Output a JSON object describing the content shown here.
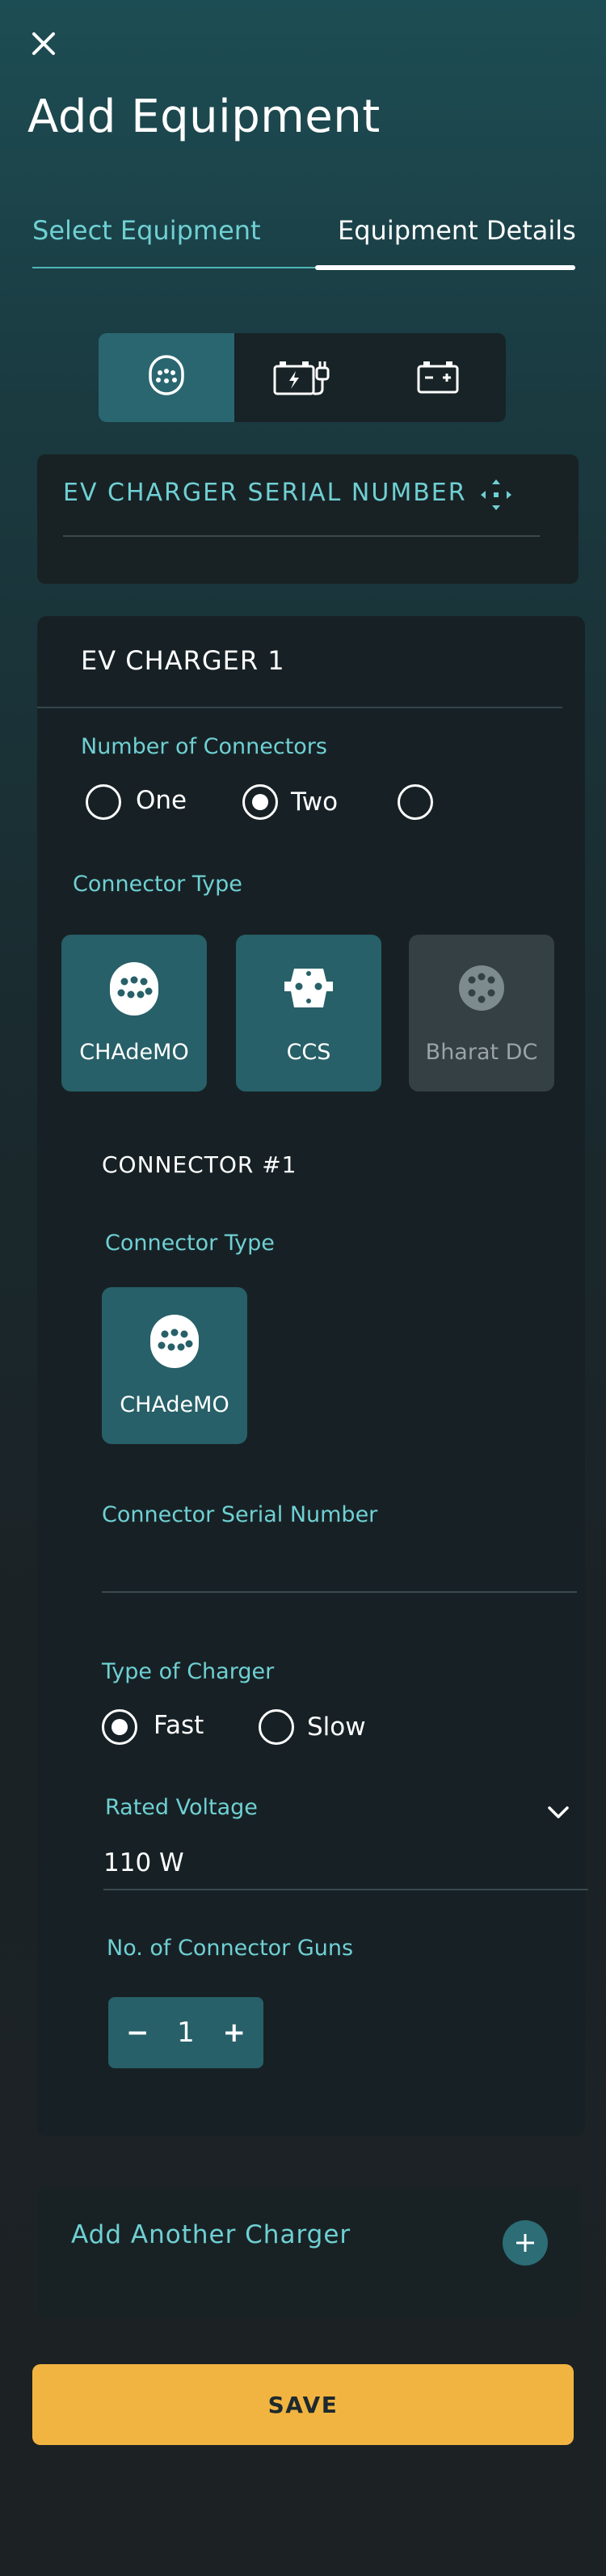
{
  "header": {
    "title": "Add Equipment",
    "close_icon": "close-icon"
  },
  "tabs": [
    {
      "label": "Select Equipment",
      "active": false
    },
    {
      "label": "Equipment Details",
      "active": true
    }
  ],
  "equipment_types": [
    {
      "icon": "ev-plug-icon",
      "active": true
    },
    {
      "icon": "battery-plug-icon",
      "active": false
    },
    {
      "icon": "battery-icon",
      "active": false
    }
  ],
  "serial": {
    "label": "EV CHARGER SERIAL NUMBER",
    "icon": "scan-icon",
    "value": ""
  },
  "charger": {
    "title": "EV CHARGER 1",
    "num_connectors": {
      "label": "Number of Connectors",
      "options": [
        "One",
        "Two",
        ""
      ],
      "selected": "Two"
    },
    "connector_type": {
      "label": "Connector Type",
      "options": [
        {
          "label": "CHAdeMO",
          "icon": "chademo-icon",
          "enabled": true
        },
        {
          "label": "CCS",
          "icon": "ccs-icon",
          "enabled": true
        },
        {
          "label": "Bharat DC",
          "icon": "bharat-dc-icon",
          "enabled": false
        }
      ]
    },
    "connector": {
      "title": "CONNECTOR #1",
      "type_label": "Connector Type",
      "type_value": "CHAdeMO",
      "serial_label": "Connector Serial Number",
      "serial_value": "",
      "charger_type_label": "Type of Charger",
      "charger_type_options": [
        "Fast",
        "Slow"
      ],
      "charger_type_selected": "Fast",
      "voltage_label": "Rated Voltage",
      "voltage_value": "110 W",
      "guns_label": "No. of Connector Guns",
      "guns_value": "1",
      "minus": "−",
      "plus": "+"
    }
  },
  "add_another": {
    "label": "Add Another Charger"
  },
  "save": {
    "label": "SAVE"
  },
  "colors": {
    "accent": "#6fd0d3",
    "tile": "#276068",
    "save": "#f2b441"
  }
}
